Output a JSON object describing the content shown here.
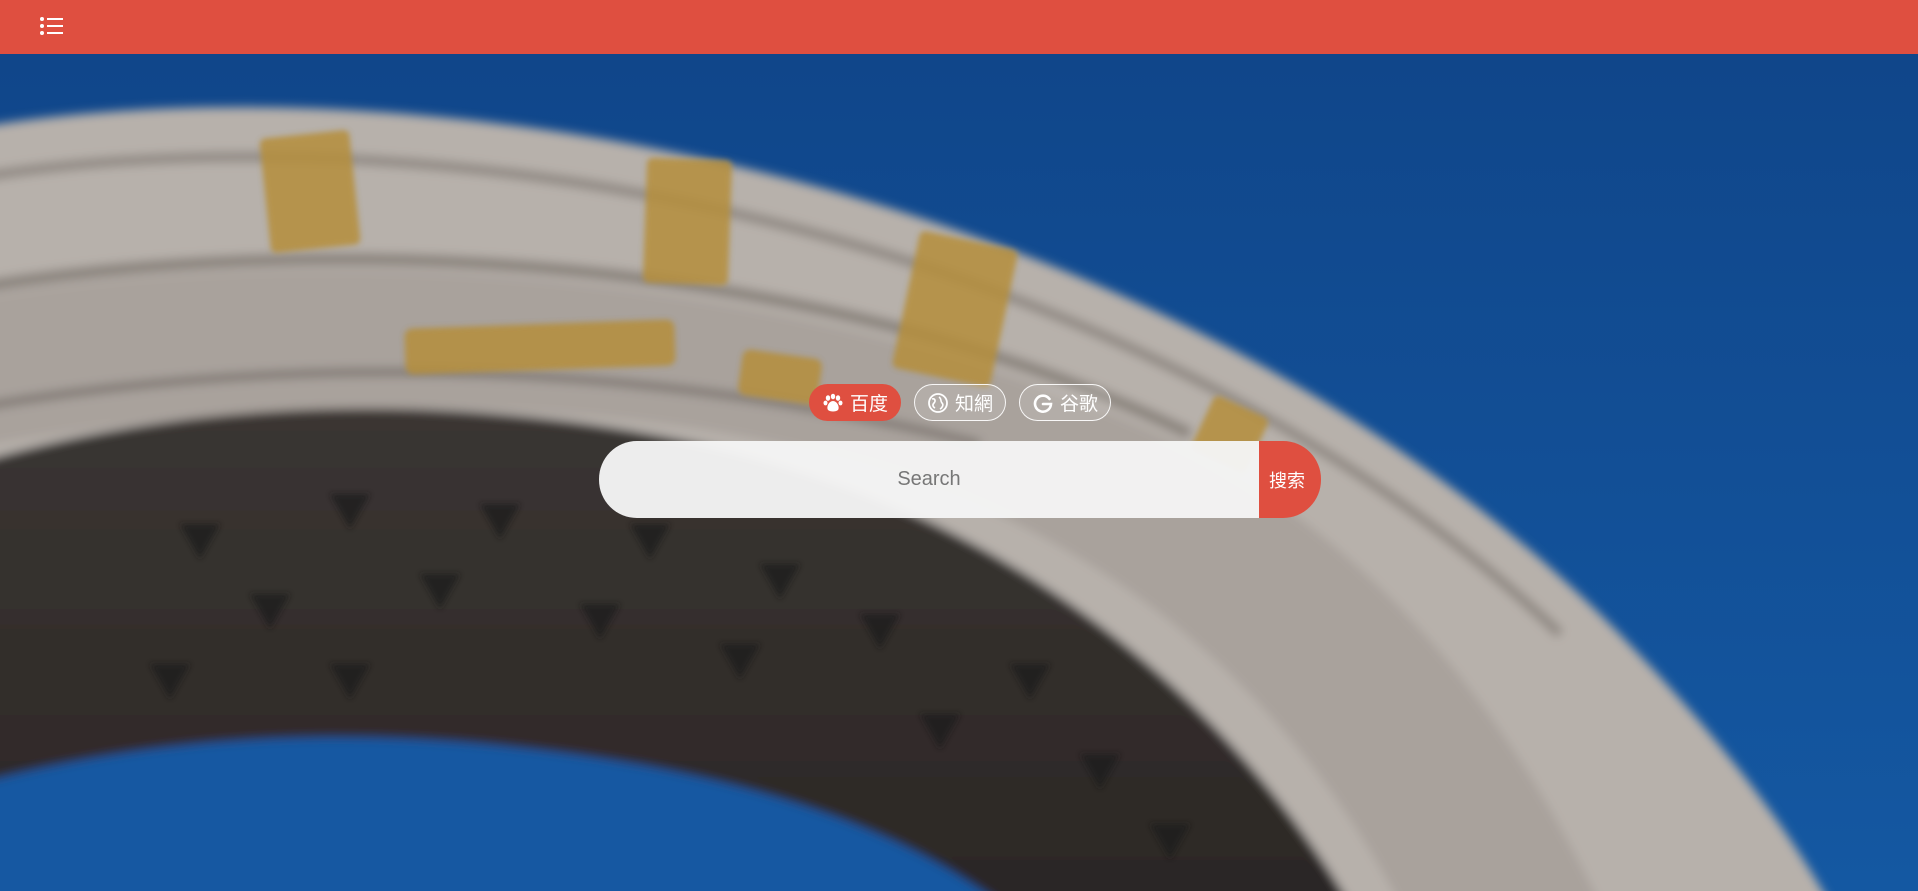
{
  "topbar": {
    "color": "#df4f40",
    "menu_icon": "list-menu-icon"
  },
  "background": {
    "description_icon": "campus-gate-arch-photo",
    "sky_color": "#11519a",
    "arch_color": "#b9b3ad"
  },
  "engines": [
    {
      "label": "百度",
      "icon": "baidu-paw-icon",
      "active": true
    },
    {
      "label": "知網",
      "icon": "cnki-globe-icon",
      "active": false
    },
    {
      "label": "谷歌",
      "icon": "google-g-icon",
      "active": false
    }
  ],
  "search": {
    "placeholder": "Search",
    "value": "",
    "button_label": "搜索"
  },
  "colors": {
    "accent": "#df4f40",
    "white": "#ffffff"
  }
}
